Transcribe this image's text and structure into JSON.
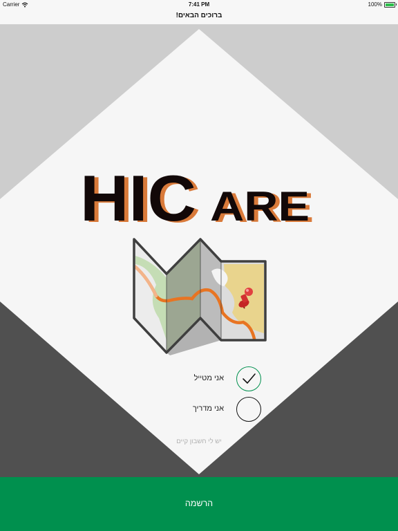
{
  "status_bar": {
    "carrier": "Carrier",
    "time": "7:41 PM",
    "battery_percent": "100%",
    "battery_level": 1.0,
    "icons": [
      "wifi-icon",
      "battery-icon"
    ]
  },
  "nav": {
    "title": "ברוכים הבאים!"
  },
  "logo": {
    "part1": "HIC",
    "part2": "ARE"
  },
  "illustration": {
    "icon": "folded-map-with-pin-icon"
  },
  "roles": [
    {
      "label": "אני מטייל",
      "selected": true
    },
    {
      "label": "אני מדריך",
      "selected": false
    }
  ],
  "existing_account_link": "יש לי חשבון קיים",
  "register_button": {
    "label": "הרשמה"
  },
  "colors": {
    "bg_light_gray": "#cdcdcd",
    "bg_dark_gray": "#505050",
    "diamond": "#f6f6f6",
    "accent_green": "#00904e",
    "logo_black": "#120808",
    "logo_orange": "#d97a3a",
    "route_orange": "#e87422",
    "pin_red": "#d02a2a"
  }
}
